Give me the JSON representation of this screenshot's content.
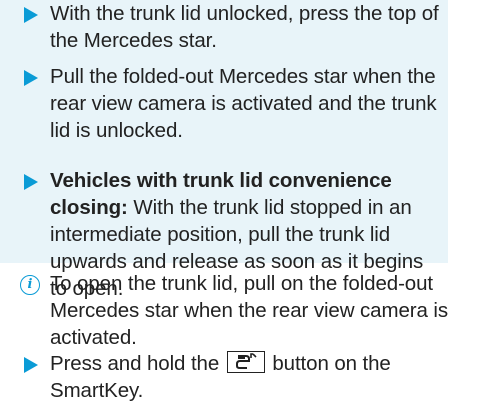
{
  "steps": [
    {
      "text": "With the trunk lid unlocked, press the top of the Mercedes star."
    },
    {
      "text": "Pull the folded-out Mercedes star when the rear view camera is activated and the trunk lid is unlocked."
    },
    {
      "bold_prefix": "Vehicles with trunk lid convenience closing:",
      "text": " With the trunk lid stopped in an intermediate position, pull the trunk lid upwards and release as soon as it begins to open."
    }
  ],
  "info": {
    "text": "To open the trunk lid, pull on the folded-out Mercedes star when the rear view camera is activated."
  },
  "last_step": {
    "before": "Press and hold the ",
    "button_icon": "trunk-open-key-icon",
    "after": " button on the SmartKey."
  },
  "colors": {
    "accent": "#0a9bd6",
    "step_background": "#e8f4f9",
    "text": "#222222"
  }
}
